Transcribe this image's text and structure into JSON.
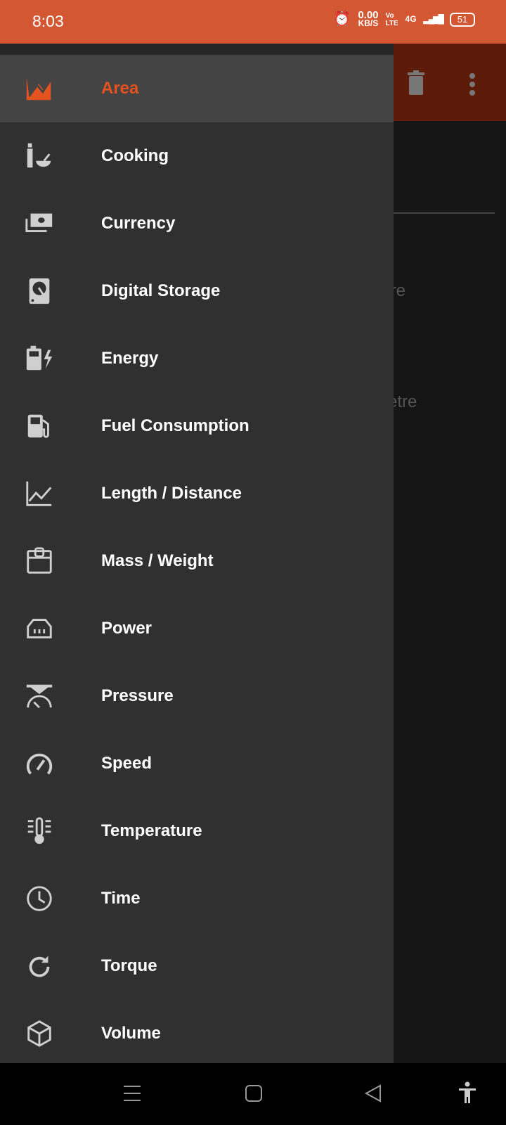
{
  "status_bar": {
    "time": "8:03",
    "net_speed": "0.00",
    "net_unit": "KB/S",
    "volte": "Vo LTE",
    "network": "4G",
    "battery": "51"
  },
  "background": {
    "partial_text_1": "tre",
    "partial_text_2": "etre"
  },
  "accent_color": "#e4531f",
  "drawer": {
    "items": [
      {
        "label": "Area",
        "icon": "area-chart-icon",
        "selected": true
      },
      {
        "label": "Cooking",
        "icon": "cooking-icon"
      },
      {
        "label": "Currency",
        "icon": "money-icon"
      },
      {
        "label": "Digital Storage",
        "icon": "hard-drive-icon"
      },
      {
        "label": "Energy",
        "icon": "battery-bolt-icon"
      },
      {
        "label": "Fuel Consumption",
        "icon": "fuel-pump-icon"
      },
      {
        "label": "Length / Distance",
        "icon": "line-chart-icon"
      },
      {
        "label": "Mass / Weight",
        "icon": "weight-icon"
      },
      {
        "label": "Power",
        "icon": "power-socket-icon"
      },
      {
        "label": "Pressure",
        "icon": "pressure-gauge-icon"
      },
      {
        "label": "Speed",
        "icon": "speedometer-icon"
      },
      {
        "label": "Temperature",
        "icon": "thermometer-icon"
      },
      {
        "label": "Time",
        "icon": "clock-icon"
      },
      {
        "label": "Torque",
        "icon": "rotate-icon"
      },
      {
        "label": "Volume",
        "icon": "cube-icon"
      }
    ]
  }
}
